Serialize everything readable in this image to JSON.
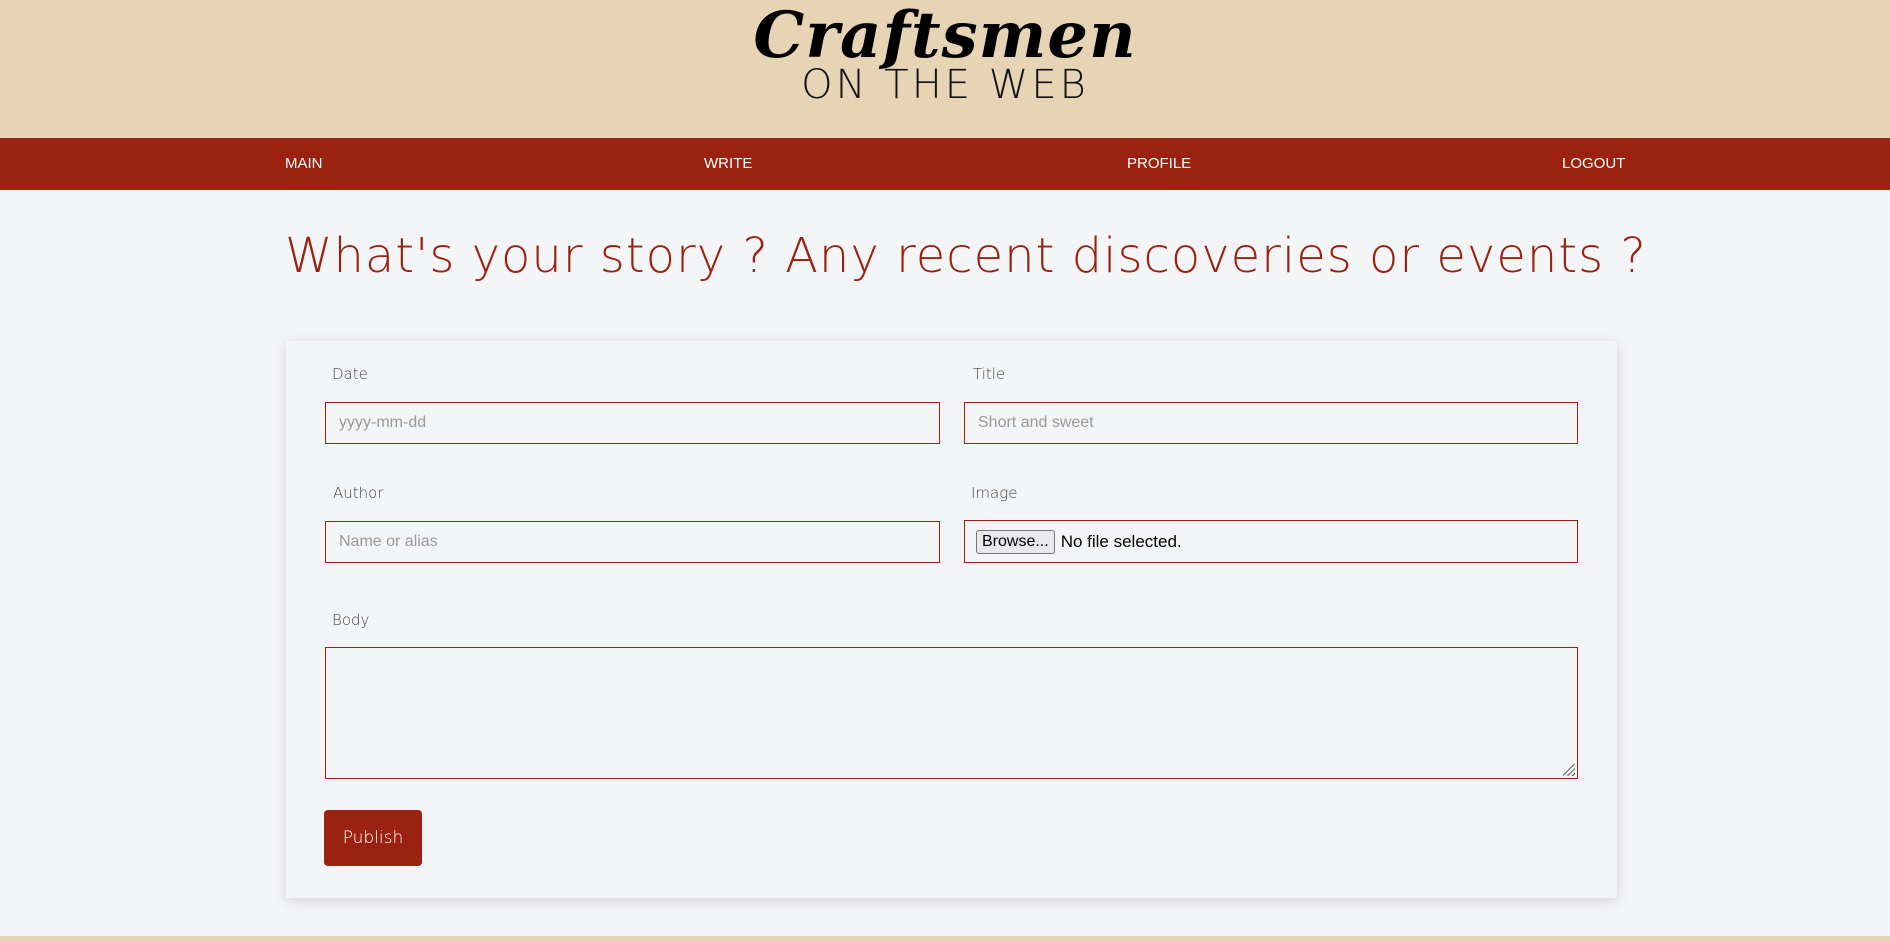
{
  "brand": {
    "title": "Craftsmen",
    "subtitle": "ON THE WEB"
  },
  "nav": {
    "main": "MAIN",
    "write": "WRITE",
    "profile": "PROFILE",
    "logout": "LOGOUT"
  },
  "headline": "What's your story ? Any recent discoveries or events ?",
  "form": {
    "date_label": "Date",
    "date_placeholder": "yyyy-mm-dd",
    "title_label": "Title",
    "title_placeholder": "Short and sweet",
    "author_label": "Author",
    "author_placeholder": "Name or alias",
    "image_label": "Image",
    "browse_label": "Browse...",
    "no_file_text": "No file selected.",
    "body_label": "Body",
    "publish_label": "Publish"
  },
  "colors": {
    "accent": "#9b2210",
    "header_bg": "#e6d4b5",
    "page_bg": "#f4f5f7"
  }
}
